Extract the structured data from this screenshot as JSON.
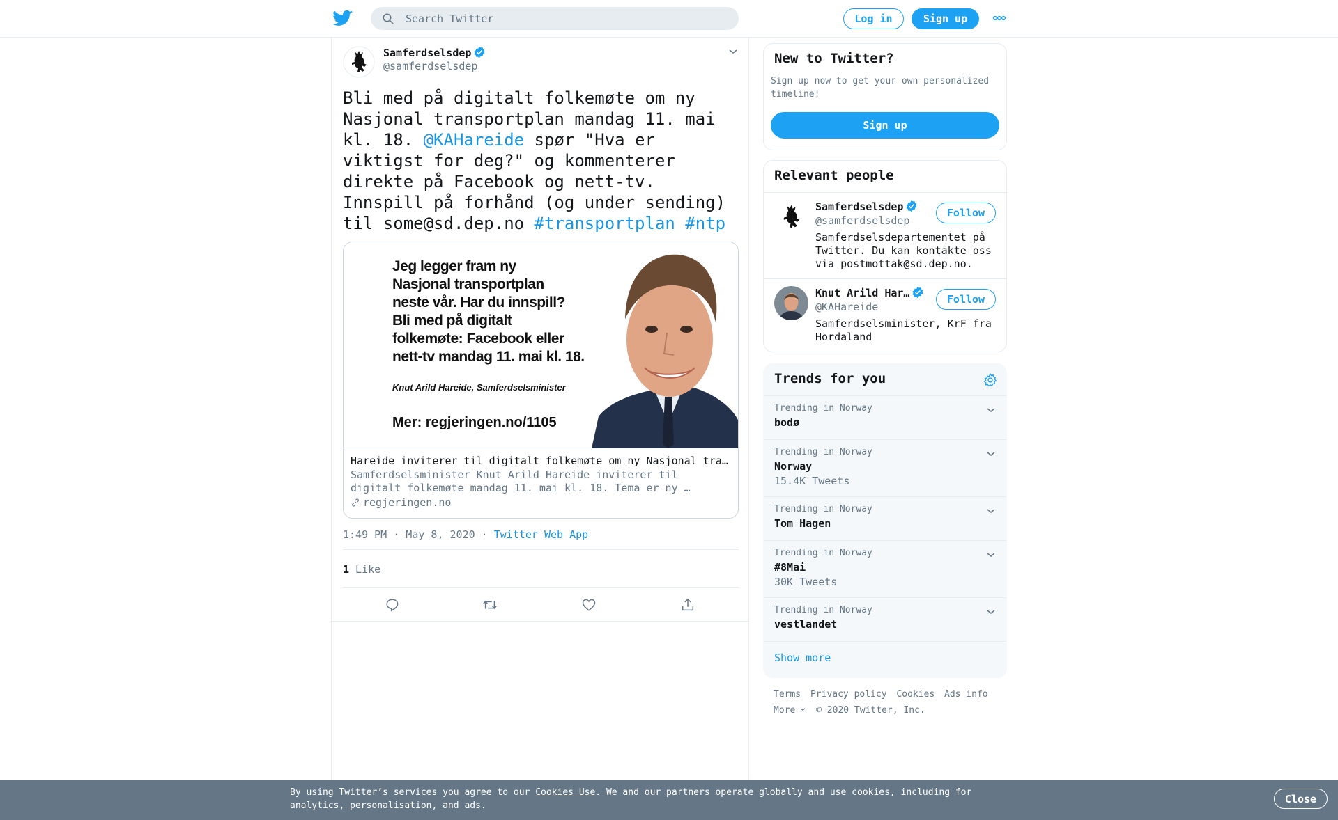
{
  "topbar": {
    "search_placeholder": "Search Twitter",
    "login_label": "Log in",
    "signup_label": "Sign up"
  },
  "tweet": {
    "author_name": "Samferdselsdep",
    "author_handle": "@samferdselsdep",
    "text_1": "Bli med på digitalt folkemøte om ny Nasjonal transportplan mandag 11. mai kl. 18. ",
    "mention": "@KAHareide",
    "text_2": " spør \"Hva er viktigst for deg?\" og kommenterer direkte på Facebook og nett-tv. Innspill på forhånd (og under sending) til some@sd.dep.no ",
    "hashtag_1": "#transportplan",
    "hashtag_2": "#ntp",
    "card": {
      "poster_lines": [
        "Jeg legger fram ny",
        "Nasjonal transportplan",
        "neste vår. Har du innspill?",
        "Bli med på digitalt",
        "folkemøte: Facebook eller",
        "nett-tv mandag 11. mai kl. 18."
      ],
      "poster_byline": "Knut Arild Hareide, Samferdselsminister",
      "poster_more": "Mer: regjeringen.no/1105",
      "title": "Hareide inviterer til digitalt folkemøte om ny Nasjonal transportplan",
      "description": "Samferdselsminister Knut Arild Hareide inviterer til digitalt folkemøte mandag 11. mai kl. 18. Tema er ny …",
      "domain": "regjeringen.no"
    },
    "time": "1:49 PM · May 8, 2020",
    "separator": " · ",
    "source": "Twitter Web App",
    "like_count": "1",
    "like_label": " Like"
  },
  "sidebar": {
    "new_title": "New to Twitter?",
    "new_desc": "Sign up now to get your own personalized timeline!",
    "new_signup_label": "Sign up",
    "relevant_title": "Relevant people",
    "people": [
      {
        "name": "Samferdselsdep",
        "handle": "@samferdselsdep",
        "bio": "Samferdselsdepartementet på Twitter. Du kan kontakte oss via postmottak@sd.dep.no.",
        "follow_label": "Follow"
      },
      {
        "name": "Knut Arild Har…",
        "handle": "@KAHareide",
        "bio": "Samferdselsminister, KrF fra Hordaland",
        "follow_label": "Follow"
      }
    ],
    "trends_title": "Trends for you",
    "trends": [
      {
        "context": "Trending in Norway",
        "name": "bodø",
        "count": ""
      },
      {
        "context": "Trending in Norway",
        "name": "Norway",
        "count": "15.4K Tweets"
      },
      {
        "context": "Trending in Norway",
        "name": "Tom Hagen",
        "count": ""
      },
      {
        "context": "Trending in Norway",
        "name": "#8Mai",
        "count": "30K Tweets"
      },
      {
        "context": "Trending in Norway",
        "name": "vestlandet",
        "count": ""
      }
    ],
    "show_more": "Show more",
    "footer": {
      "terms": "Terms",
      "privacy": "Privacy policy",
      "cookies": "Cookies",
      "ads": "Ads info",
      "more": "More",
      "copyright": "© 2020 Twitter, Inc."
    }
  },
  "cookie_banner": {
    "text_1": "By using Twitter’s services you agree to our ",
    "link": "Cookies Use",
    "text_2": ". We and our partners operate globally and use cookies, including for analytics, personalisation, and ads.",
    "close_label": "Close"
  },
  "colors": {
    "accent": "#1da1f2",
    "link": "#1b95e0",
    "secondary_text": "#657786",
    "cookie_bg": "#657786"
  }
}
